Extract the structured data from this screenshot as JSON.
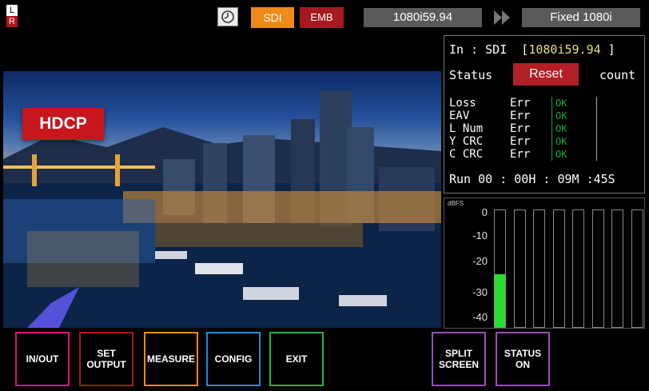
{
  "top": {
    "lr_l": "L",
    "lr_r": "R",
    "input_chip": "SDI",
    "audio_chip": "EMB",
    "input_format": "1080i59.94",
    "output_format": "Fixed 1080i",
    "icons": [
      "clock-icon",
      "double-chevron-right-icon"
    ]
  },
  "video": {
    "badge": "HDCP"
  },
  "status_panel": {
    "in_label": "In : SDI  [",
    "in_format": "1080i59.94",
    "in_close": " ]",
    "status_label": "Status",
    "reset_label": "Reset",
    "count_label": "count",
    "errors": [
      {
        "name": "Loss",
        "label": "Err",
        "value": "OK"
      },
      {
        "name": "EAV",
        "label": "Err",
        "value": "OK"
      },
      {
        "name": "L Num",
        "label": "Err",
        "value": "OK"
      },
      {
        "name": "Y CRC",
        "label": "Err",
        "value": "OK"
      },
      {
        "name": "C CRC",
        "label": "Err",
        "value": "OK"
      }
    ],
    "run": "Run 00 : 00H : 09M :45S"
  },
  "meter": {
    "unit": "dBFS",
    "ticks": [
      "0",
      "-10",
      "-20",
      "-30",
      "-40"
    ],
    "channels": 8,
    "level_fractions": [
      0.45,
      0,
      0,
      0,
      0,
      0,
      0,
      0
    ]
  },
  "buttons": [
    {
      "label": "IN/OUT",
      "color": "#d0177f"
    },
    {
      "label": "SET\nOUTPUT",
      "color": "#a51a1f"
    },
    {
      "label": "MEASURE",
      "color": "#f08a18"
    },
    {
      "label": "CONFIG",
      "color": "#1f8fd8"
    },
    {
      "label": "EXIT",
      "color": "#2fb04a"
    },
    {
      "label": "SPLIT\nSCREEN",
      "color": "#9a4dbb"
    },
    {
      "label": "STATUS\nON",
      "color": "#9a4dbb"
    }
  ],
  "colors": {
    "ok": "#1aa83a",
    "meter_fill": "#25e02f",
    "accent_orange": "#f08a18",
    "accent_red": "#b21f25"
  }
}
